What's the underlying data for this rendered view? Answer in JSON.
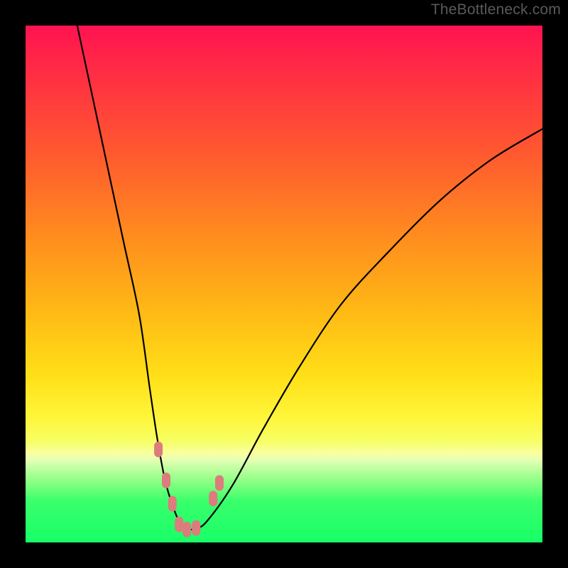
{
  "watermark": "TheBottleneck.com",
  "chart_data": {
    "type": "line",
    "title": "",
    "xlabel": "",
    "ylabel": "",
    "xlim": [
      0,
      100
    ],
    "ylim": [
      0,
      100
    ],
    "series": [
      {
        "name": "bottleneck-curve",
        "x": [
          10,
          13,
          16,
          19,
          22,
          24,
          25.5,
          27,
          28.5,
          30,
          31.5,
          33,
          35,
          40,
          46,
          53,
          61,
          70,
          80,
          90,
          100
        ],
        "y": [
          100,
          86,
          72,
          58,
          44,
          30,
          20,
          12,
          7,
          3.5,
          2.5,
          2.8,
          4,
          11,
          22,
          34,
          46,
          56,
          66,
          74,
          80
        ]
      }
    ],
    "markers": [
      {
        "name": "pink-dot-left-1",
        "x": 25.7,
        "y": 18
      },
      {
        "name": "pink-dot-left-2",
        "x": 27.2,
        "y": 12
      },
      {
        "name": "pink-dot-left-3",
        "x": 28.4,
        "y": 7.5
      },
      {
        "name": "pink-dot-bottom-1",
        "x": 29.7,
        "y": 3.5
      },
      {
        "name": "pink-dot-bottom-2",
        "x": 31.2,
        "y": 2.5
      },
      {
        "name": "pink-dot-bottom-3",
        "x": 33.0,
        "y": 2.8
      },
      {
        "name": "pink-dot-right-1",
        "x": 36.3,
        "y": 8.5
      },
      {
        "name": "pink-dot-right-2",
        "x": 37.5,
        "y": 11.5
      }
    ],
    "gradient_colors": {
      "top": "#ff1351",
      "mid": "#ffe018",
      "bottom": "#18ff67"
    }
  }
}
